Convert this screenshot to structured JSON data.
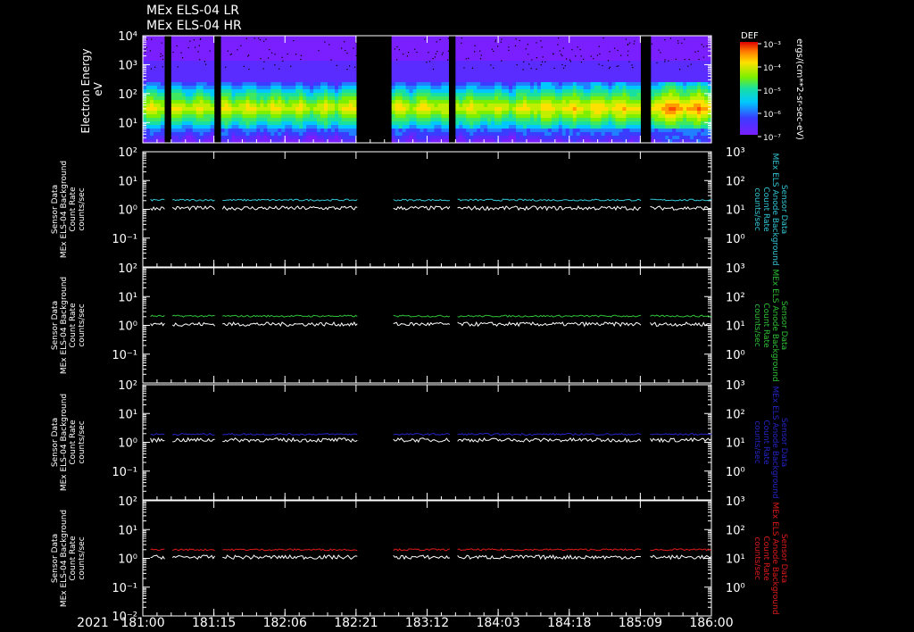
{
  "titles": [
    "MEx ELS-04 LR",
    "MEx ELS-04 HR"
  ],
  "colors": {
    "background": "#000000",
    "axis": "#ffffff",
    "panel1": "#33c7d6",
    "panel2": "#2ec236",
    "panel3": "#2424c8",
    "panel4": "#e01a1a",
    "white_trace": "#ffffff"
  },
  "chart_data": [
    {
      "type": "heatmap",
      "title": "",
      "ylabel": "Electron Energy\neV",
      "ylim": [
        2,
        10000
      ],
      "yscale": "log",
      "yticks": [
        "10¹",
        "10²",
        "10³",
        "10⁴"
      ],
      "colorbar": {
        "label": "DEF",
        "units": "ergs/(cm**2-sr-sec-eV)",
        "ticks": [
          "10⁻³",
          "10⁻⁴",
          "10⁻⁵",
          "10⁻⁶",
          "10⁻⁷"
        ]
      },
      "gaps_day_fraction": [
        [
          181.2,
          181.26
        ],
        [
          181.64,
          181.7
        ],
        [
          182.89,
          183.19
        ],
        [
          183.7,
          183.76
        ],
        [
          185.39,
          185.46
        ]
      ]
    },
    {
      "type": "line",
      "ylabel": "Sensor Data\nMEx ELS-04 Background\nCount Rate\ncounts/sec",
      "right_label": [
        "Sensor Data",
        "MEx ELS Anode Background",
        "Count Rate",
        "counts/sec"
      ],
      "left_ylim": [
        0.01,
        100
      ],
      "right_ylim": [
        0.1,
        1000
      ],
      "yscale": "log",
      "left_ticks": [
        "10²",
        "10¹",
        "10⁰",
        "10⁻¹"
      ],
      "right_ticks": [
        "10³",
        "10²",
        "10¹",
        "10⁰"
      ],
      "series": [
        {
          "level": 2.1
        },
        {
          "level": 1.1
        }
      ]
    },
    {
      "type": "line",
      "ylabel": "Sensor Data\nMEx ELS-04 Background\nCount Rate\ncounts/sec",
      "right_label": [
        "Sensor Data",
        "MEx ELS Anode Background",
        "Count Rate",
        "counts/sec"
      ],
      "left_ylim": [
        0.01,
        100
      ],
      "right_ylim": [
        0.1,
        1000
      ],
      "yscale": "log",
      "left_ticks": [
        "10²",
        "10¹",
        "10⁰",
        "10⁻¹"
      ],
      "right_ticks": [
        "10³",
        "10²",
        "10¹",
        "10⁰"
      ],
      "series": [
        {
          "level": 2.1
        },
        {
          "level": 1.1
        }
      ]
    },
    {
      "type": "line",
      "ylabel": "Sensor Data\nMEx ELS-04 Background\nCount Rate\ncounts/sec",
      "right_label": [
        "Sensor Data",
        "MEx ELS Anode Background",
        "Count Rate",
        "counts/sec"
      ],
      "left_ylim": [
        0.01,
        100
      ],
      "right_ylim": [
        0.1,
        1000
      ],
      "yscale": "log",
      "left_ticks": [
        "10²",
        "10¹",
        "10⁰",
        "10⁻¹"
      ],
      "right_ticks": [
        "10³",
        "10²",
        "10¹",
        "10⁰"
      ],
      "series": [
        {
          "level": 1.9
        },
        {
          "level": 1.2
        }
      ]
    },
    {
      "type": "line",
      "ylabel": "Sensor Data\nMEx ELS-04 Background\nCount Rate\ncounts/sec",
      "right_label": [
        "Sensor Data",
        "MEx ELS Anode Background",
        "Count Rate",
        "counts/sec"
      ],
      "left_ylim": [
        0.01,
        100
      ],
      "right_ylim": [
        0.1,
        1000
      ],
      "yscale": "log",
      "left_ticks": [
        "10²",
        "10¹",
        "10⁰",
        "10⁻¹",
        "10⁻²"
      ],
      "right_ticks": [
        "10³",
        "10²",
        "10¹",
        "10⁰"
      ],
      "series": [
        {
          "level": 2.0
        },
        {
          "level": 1.1
        }
      ]
    }
  ],
  "xaxis": {
    "year": "2021",
    "ticks": [
      "181:00",
      "181:15",
      "182:06",
      "182:21",
      "183:12",
      "184:03",
      "184:18",
      "185:09",
      "186:00"
    ]
  }
}
